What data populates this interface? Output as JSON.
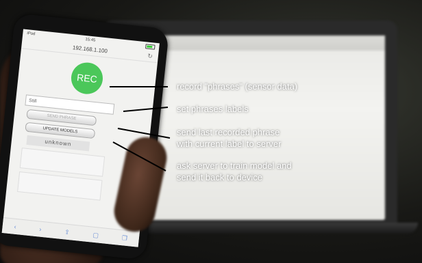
{
  "phone": {
    "status": {
      "carrier": "iPod",
      "time": "15:45"
    },
    "url": "192.168.1.100",
    "rec_label": "REC",
    "label_input_value": "Still",
    "send_phrase_label": "SEND PHRASE",
    "update_models_label": "UPDATE MODELS",
    "result_label": "unknown",
    "toolbar": {
      "back": "‹",
      "forward": "›",
      "share": "⇪",
      "bookmarks": "▢",
      "tabs": "❐"
    }
  },
  "annotations": {
    "rec": "record \"phrases\" (sensor data)",
    "labels": "set phrases labels",
    "send_line1": "send last recorded phrase",
    "send_line2": "with current label to server",
    "train_line1": "ask server to train model and",
    "train_line2": "send it back to device"
  },
  "colors": {
    "rec_button": "#4bc75a",
    "annotation_text": "#ffffff",
    "annotation_line": "#000000"
  }
}
